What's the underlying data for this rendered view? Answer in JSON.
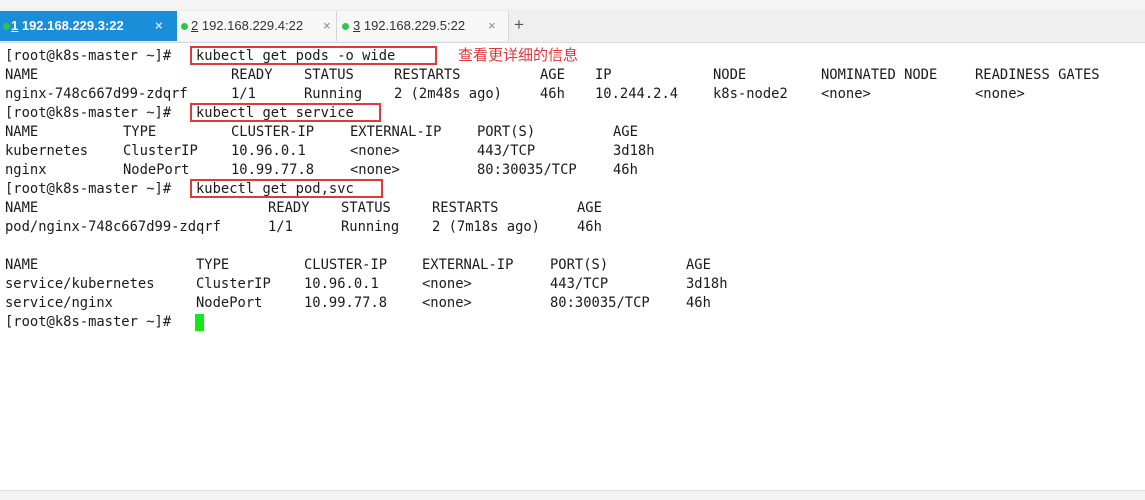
{
  "tabs": [
    {
      "number": "1",
      "label": " 192.168.229.3:22",
      "close": "×",
      "active": true
    },
    {
      "number": "2",
      "label": " 192.168.229.4:22",
      "close": "×",
      "active": false
    },
    {
      "number": "3",
      "label": " 192.168.229.5:22",
      "close": "×",
      "active": false
    }
  ],
  "new_tab_label": "+",
  "prompt": "[root@k8s-master ~]#",
  "commands": [
    "kubectl get pods -o wide",
    "kubectl get service",
    "kubectl get pod,svc"
  ],
  "annotation": "查看更详细的信息",
  "pods_wide": {
    "headers": [
      "NAME",
      "READY",
      "STATUS",
      "RESTARTS",
      "AGE",
      "IP",
      "NODE",
      "NOMINATED NODE",
      "READINESS GATES"
    ],
    "rows": [
      [
        "nginx-748c667d99-zdqrf",
        "1/1",
        "Running",
        "2 (2m48s ago)",
        "46h",
        "10.244.2.4",
        "k8s-node2",
        "<none>",
        "<none>"
      ]
    ]
  },
  "services": {
    "headers": [
      "NAME",
      "TYPE",
      "CLUSTER-IP",
      "EXTERNAL-IP",
      "PORT(S)",
      "AGE"
    ],
    "rows": [
      [
        "kubernetes",
        "ClusterIP",
        "10.96.0.1",
        "<none>",
        "443/TCP",
        "3d18h"
      ],
      [
        "nginx",
        "NodePort",
        "10.99.77.8",
        "<none>",
        "80:30035/TCP",
        "46h"
      ]
    ]
  },
  "pod_svc_pods": {
    "headers": [
      "NAME",
      "READY",
      "STATUS",
      "RESTARTS",
      "AGE"
    ],
    "rows": [
      [
        "pod/nginx-748c667d99-zdqrf",
        "1/1",
        "Running",
        "2 (7m18s ago)",
        "46h"
      ]
    ]
  },
  "pod_svc_services": {
    "headers": [
      "NAME",
      "TYPE",
      "CLUSTER-IP",
      "EXTERNAL-IP",
      "PORT(S)",
      "AGE"
    ],
    "rows": [
      [
        "service/kubernetes",
        "ClusterIP",
        "10.96.0.1",
        "<none>",
        "443/TCP",
        "3d18h"
      ],
      [
        "service/nginx",
        "NodePort",
        "10.99.77.8",
        "<none>",
        "80:30035/TCP",
        "46h"
      ]
    ]
  },
  "colors": {
    "active_tab": "#1a8ed8",
    "status_dot": "#2ec44a",
    "highlight_box": "#e0393d",
    "cursor": "#19e619"
  }
}
